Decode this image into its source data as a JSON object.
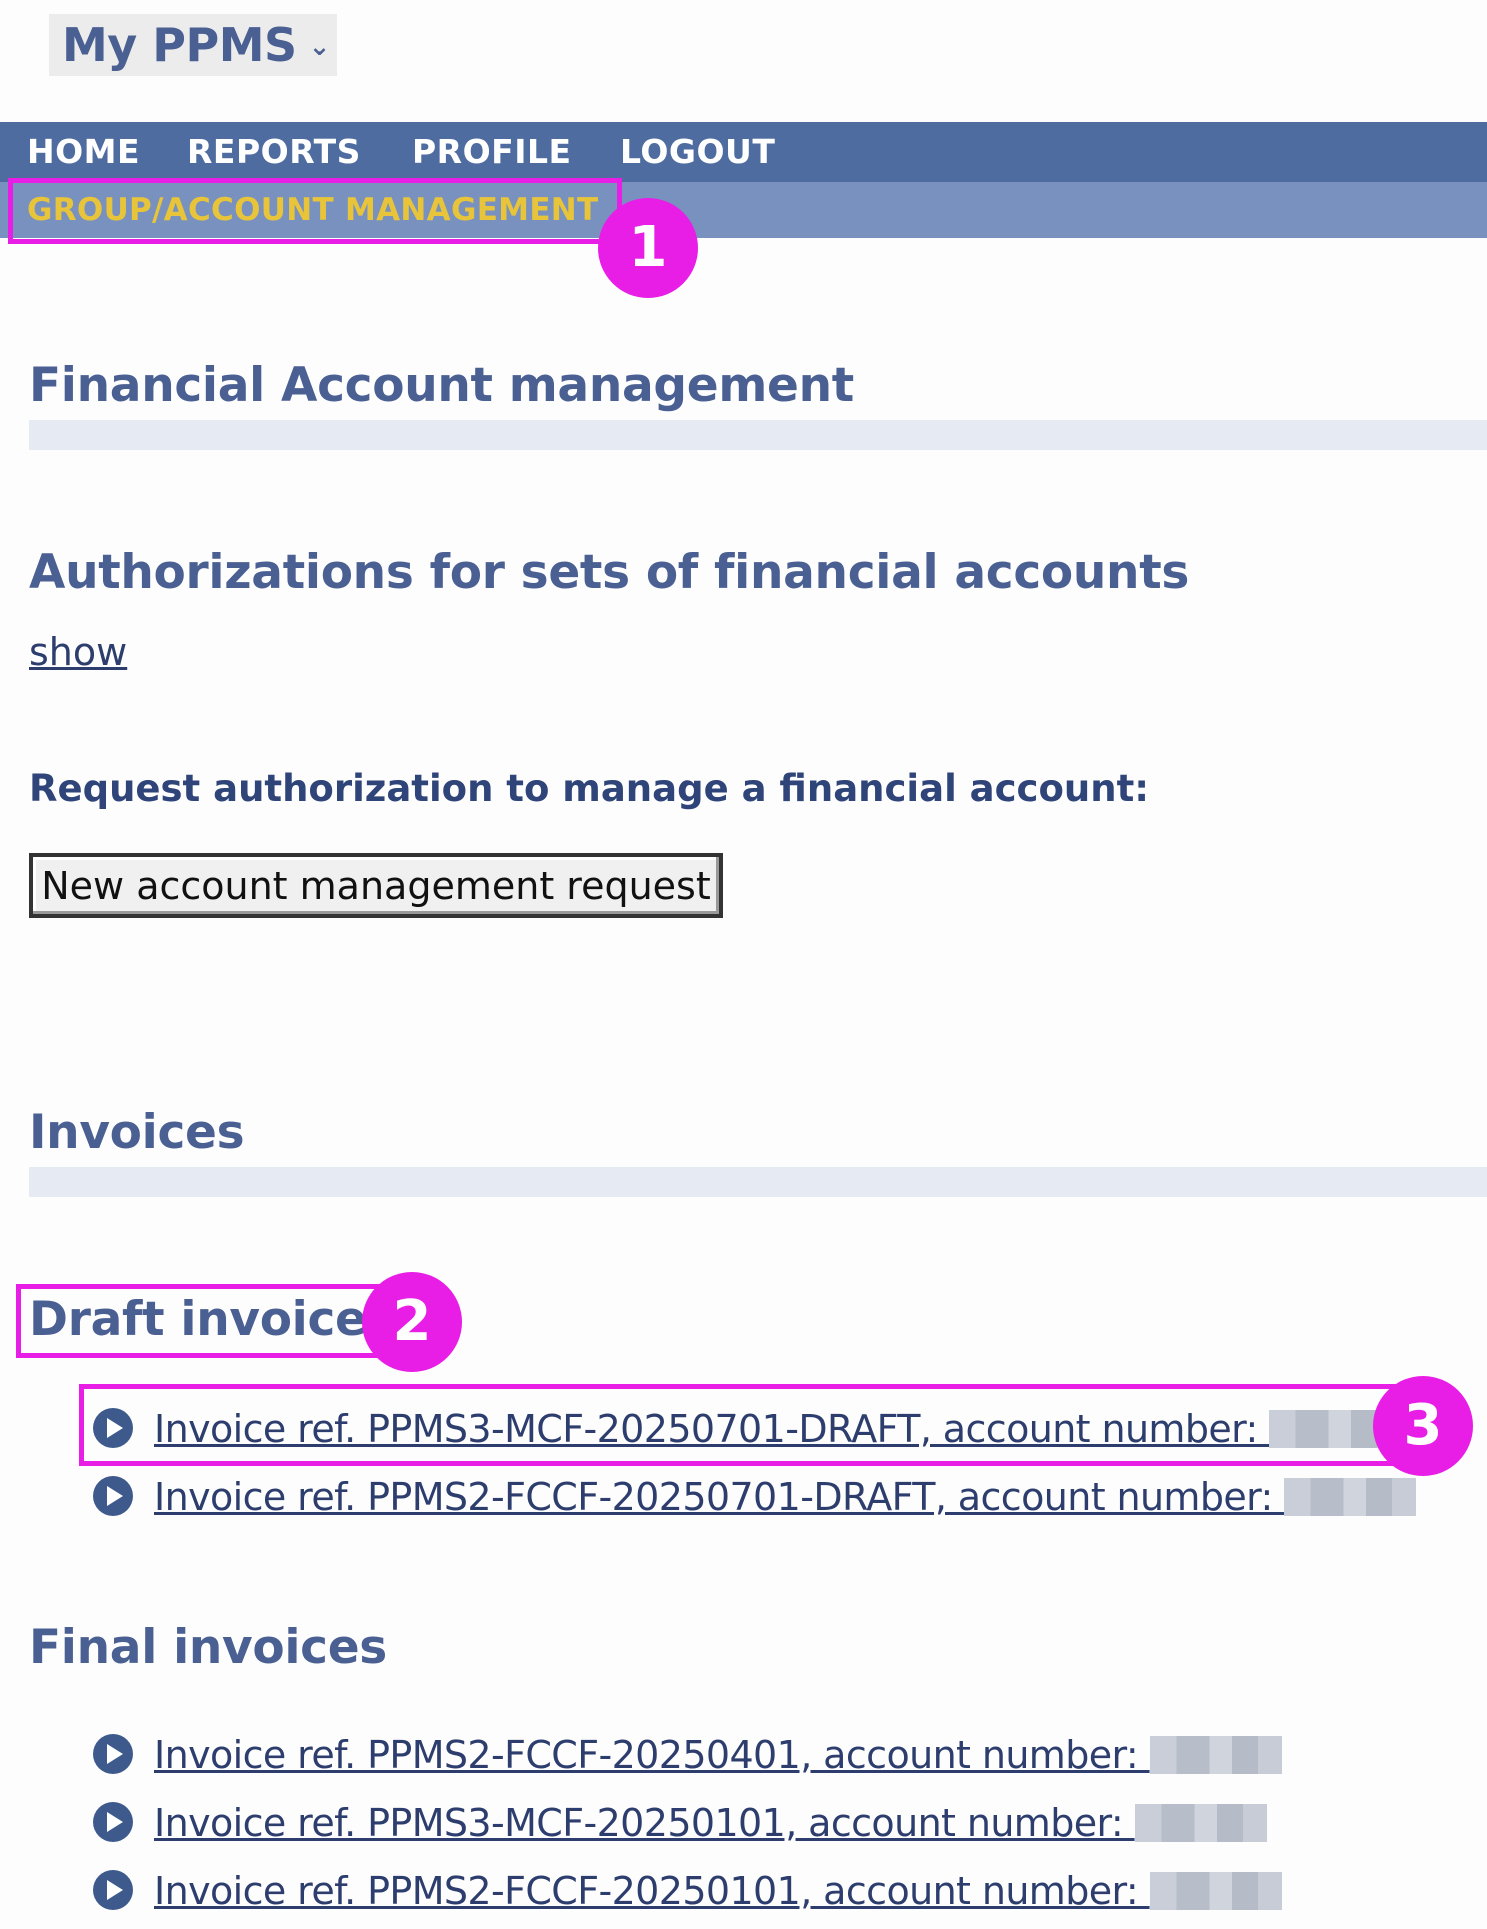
{
  "app_menu": {
    "label": "My PPMS"
  },
  "nav": {
    "items": [
      "HOME",
      "REPORTS",
      "PROFILE",
      "LOGOUT"
    ],
    "subitem": "GROUP/ACCOUNT MANAGEMENT"
  },
  "sections": {
    "financial_title": "Financial Account management",
    "authorizations_title": "Authorizations for sets of financial accounts",
    "authorizations_toggle": "show",
    "request_label": "Request authorization to manage a financial account:",
    "request_button": "New account management request",
    "invoices_title": "Invoices",
    "draft_title": "Draft invoices",
    "final_title": "Final invoices"
  },
  "draft_invoices": [
    "Invoice ref. PPMS3-MCF-20250701-DRAFT, account number: ",
    "Invoice ref. PPMS2-FCCF-20250701-DRAFT, account number: "
  ],
  "final_invoices": [
    "Invoice ref. PPMS2-FCCF-20250401, account number: ",
    "Invoice ref. PPMS3-MCF-20250101, account number: ",
    "Invoice ref. PPMS2-FCCF-20250101, account number: "
  ],
  "callouts": [
    "1",
    "2",
    "3"
  ],
  "colors": {
    "nav": "#4f6ca0",
    "subnav": "#7891be",
    "active_subitem": "#e8c43a",
    "heading": "#4a5f92",
    "callout": "#e81ee6"
  }
}
